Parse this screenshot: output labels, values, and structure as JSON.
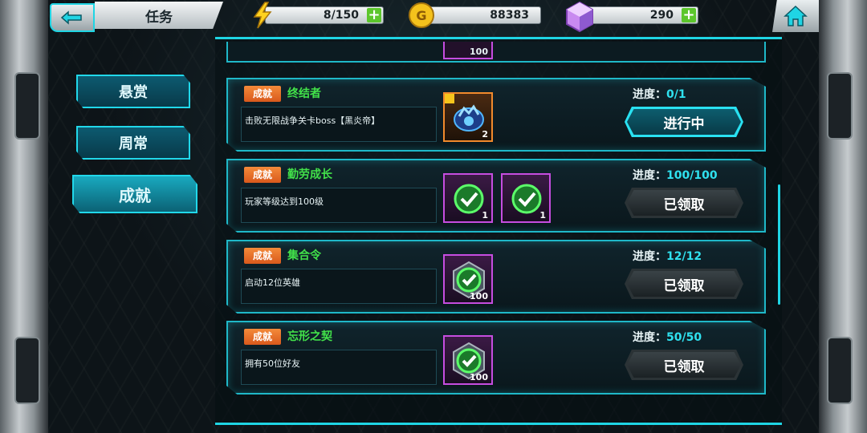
{
  "header": {
    "title": "任务",
    "energy": "8/150",
    "gold": "88383",
    "gems": "290"
  },
  "tabs": [
    {
      "label": "悬赏"
    },
    {
      "label": "周常"
    },
    {
      "label": "成就"
    }
  ],
  "partial_count": "100",
  "tasks": [
    {
      "badge": "成就",
      "name": "终结者",
      "desc": "击败无限战争关卡boss【黑炎帝】",
      "progress_label": "进度：",
      "progress": "0/1",
      "button": "进行中",
      "rewards": [
        {
          "icon": "gauntlet-icon",
          "count": "2"
        }
      ]
    },
    {
      "badge": "成就",
      "name": "勤劳成长",
      "desc": "玩家等级达到100级",
      "progress_label": "进度：",
      "progress": "100/100",
      "button": "已领取",
      "rewards": [
        {
          "icon": "check-icon",
          "count": "1"
        },
        {
          "icon": "check-icon",
          "count": "1"
        }
      ]
    },
    {
      "badge": "成就",
      "name": "集合令",
      "desc": "启动12位英雄",
      "progress_label": "进度：",
      "progress": "12/12",
      "button": "已领取",
      "rewards": [
        {
          "icon": "check-icon",
          "count": "100"
        }
      ]
    },
    {
      "badge": "成就",
      "name": "忘形之契",
      "desc": "拥有50位好友",
      "progress_label": "进度：",
      "progress": "50/50",
      "button": "已领取",
      "rewards": [
        {
          "icon": "check-icon",
          "count": "100"
        }
      ]
    }
  ]
}
